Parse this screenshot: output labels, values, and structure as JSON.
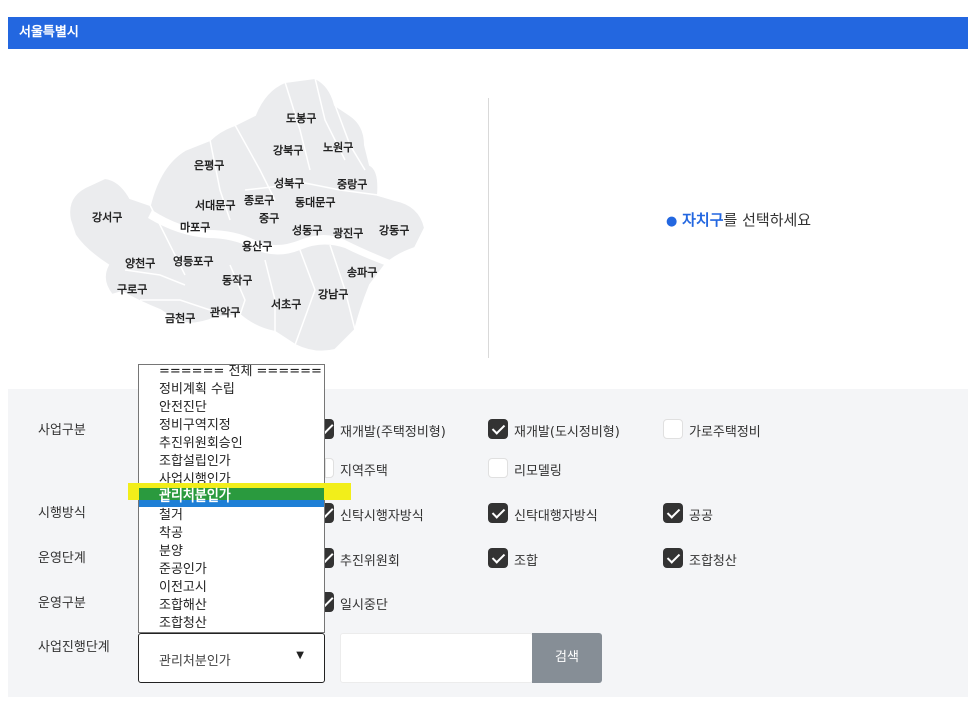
{
  "header": {
    "title": "서울특별시"
  },
  "map": {
    "districts": [
      "도봉구",
      "강북구",
      "노원구",
      "은평구",
      "성북구",
      "중랑구",
      "서대문구",
      "종로구",
      "동대문구",
      "강서구",
      "마포구",
      "중구",
      "성동구",
      "광진구",
      "강동구",
      "용산구",
      "양천구",
      "영등포구",
      "동작구",
      "송파구",
      "구로구",
      "강남구",
      "서초구",
      "관악구",
      "금천구"
    ]
  },
  "hint": {
    "icon": "location-pin-icon",
    "accent": "자치구",
    "rest": "를 선택하세요"
  },
  "filters": {
    "labels": {
      "business_type": "사업구분",
      "execution_method": "시행방식",
      "operation_stage": "운영단계",
      "operation_type": "운영구분",
      "progress_stage": "사업진행단계"
    },
    "business_type": [
      {
        "label": "재개발(주택정비형)",
        "checked": true
      },
      {
        "label": "재개발(도시정비형)",
        "checked": true
      },
      {
        "label": "가로주택정비",
        "checked": false
      },
      {
        "label": "지역주택",
        "checked": false
      },
      {
        "label": "리모델링",
        "checked": false
      }
    ],
    "execution_method": [
      {
        "label": "신탁시행자방식",
        "checked": true
      },
      {
        "label": "신탁대행자방식",
        "checked": true
      },
      {
        "label": "공공",
        "checked": true
      }
    ],
    "operation_stage": [
      {
        "label": "추진위원회",
        "checked": true
      },
      {
        "label": "조합",
        "checked": true
      },
      {
        "label": "조합청산",
        "checked": true
      }
    ],
    "operation_type": [
      {
        "label": "일시중단",
        "checked": true
      }
    ],
    "progress_select": {
      "value": "관리처분인가"
    },
    "search_button": "검색"
  },
  "dropdown": {
    "options": [
      "====== 전체 ======",
      "정비계획 수립",
      "안전진단",
      "정비구역지정",
      "추진위원회승인",
      "조합설립인가",
      "사업시행인가",
      "관리처분인가",
      "철거",
      "착공",
      "분양",
      "준공인가",
      "이전고시",
      "조합해산",
      "조합청산"
    ],
    "selected": "관리처분인가"
  },
  "colors": {
    "brand_blue": "#2367e0",
    "highlight_yellow": "#f2ee1a",
    "highlight_green": "#2a9a3e",
    "search_gray": "#868e96"
  }
}
